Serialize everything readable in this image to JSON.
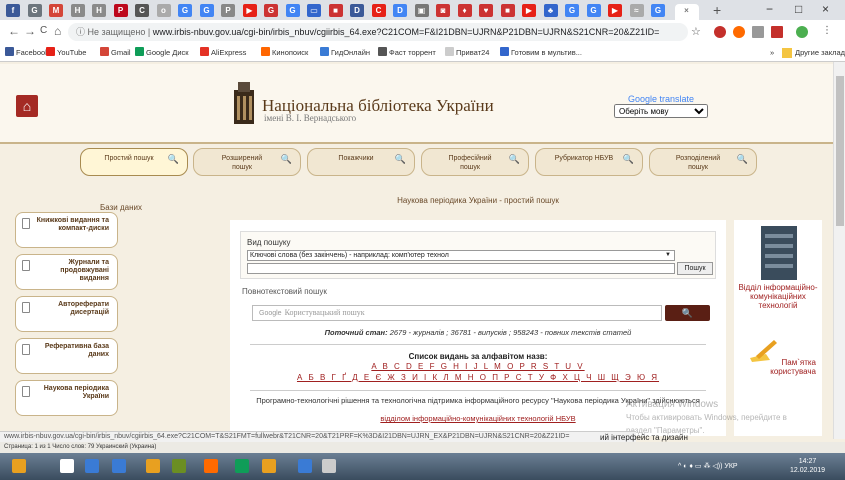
{
  "browser": {
    "tab_icons": [
      {
        "glyph": "f",
        "color": "#3b5998"
      },
      {
        "glyph": "G",
        "color": "#6c757d"
      },
      {
        "glyph": "M",
        "color": "#d44638"
      },
      {
        "glyph": "H",
        "color": "#8a8a8a"
      },
      {
        "glyph": "H",
        "color": "#8a8a8a"
      },
      {
        "glyph": "P",
        "color": "#bd081c"
      },
      {
        "glyph": "C",
        "color": "#555555"
      },
      {
        "glyph": "o",
        "color": "#aaaaaa"
      },
      {
        "glyph": "G",
        "color": "#4285f4"
      },
      {
        "glyph": "G",
        "color": "#4285f4"
      },
      {
        "glyph": "P",
        "color": "#888888"
      },
      {
        "glyph": "▶",
        "color": "#e62117"
      },
      {
        "glyph": "G",
        "color": "#cc3333"
      },
      {
        "glyph": "G",
        "color": "#4285f4"
      },
      {
        "glyph": "▭",
        "color": "#3366cc"
      },
      {
        "glyph": "■",
        "color": "#cc3333"
      },
      {
        "glyph": "D",
        "color": "#3b5998"
      },
      {
        "glyph": "C",
        "color": "#e62117"
      },
      {
        "glyph": "D",
        "color": "#4285f4"
      },
      {
        "glyph": "▣",
        "color": "#777777"
      },
      {
        "glyph": "◙",
        "color": "#cc3333"
      },
      {
        "glyph": "♦",
        "color": "#cc3333"
      },
      {
        "glyph": "♥",
        "color": "#cc3333"
      },
      {
        "glyph": "■",
        "color": "#cc3333"
      },
      {
        "glyph": "▶",
        "color": "#e62117"
      },
      {
        "glyph": "♣",
        "color": "#3366cc"
      },
      {
        "glyph": "G",
        "color": "#4285f4"
      },
      {
        "glyph": "G",
        "color": "#4285f4"
      },
      {
        "glyph": "▶",
        "color": "#e62117"
      },
      {
        "glyph": "≈",
        "color": "#aaaaaa"
      },
      {
        "glyph": "G",
        "color": "#4285f4"
      }
    ],
    "active_tab_close": "×",
    "new_tab": "+",
    "window_controls": {
      "minimize": "−",
      "maximize": "□",
      "close": "×"
    },
    "nav": {
      "back": "←",
      "forward": "→",
      "reload": "C",
      "home": "⌂"
    },
    "security": "ⓘ Не защищено",
    "url": "www.irbis-nbuv.gov.ua/cgi-bin/irbis_nbuv/cgiirbis_64.exe?C21COM=F&I21DBN=UJRN&P21DBN=UJRN&S21CNR=20&Z21ID=",
    "star": "☆",
    "bookmarks": [
      {
        "label": "Facebook",
        "color": "#3b5998"
      },
      {
        "label": "YouTube",
        "color": "#e62117"
      },
      {
        "label": "Gmail",
        "color": "#d44638"
      },
      {
        "label": "Google Диск",
        "color": "#0f9d58"
      },
      {
        "label": "AliExpress",
        "color": "#e43225"
      },
      {
        "label": "Кинопоиск",
        "color": "#f60"
      },
      {
        "label": "ГидОнлайн",
        "color": "#3a7bd5"
      },
      {
        "label": "Фаст торрент",
        "color": "#555555"
      },
      {
        "label": "Приват24",
        "color": "#cccccc"
      },
      {
        "label": "Готовим в мультив...",
        "color": "#3366cc"
      }
    ],
    "bookmarks_more": "»",
    "other_bookmarks": "Другие закладки"
  },
  "header": {
    "title": "Національна бібліотека України",
    "subtitle": "імені В. І. Вернадського",
    "home_icon": "⌂",
    "translate_brand": "Google translate",
    "translate_select": "Оберіть мову"
  },
  "search_tabs": [
    {
      "label": "Простий пошук",
      "active": true
    },
    {
      "label": "Розширений пошук",
      "active": false
    },
    {
      "label": "Покажчики",
      "active": false
    },
    {
      "label": "Професійний пошук",
      "active": false
    },
    {
      "label": "Рубрикатор НБУВ",
      "active": false
    },
    {
      "label": "Розподілений пошук",
      "active": false
    }
  ],
  "sidebar": {
    "title": "Бази даних",
    "items": [
      {
        "label": "Книжкові видання та компакт-диски"
      },
      {
        "label": "Журнали та продовжувані видання"
      },
      {
        "label": "Автореферати дисертацій"
      },
      {
        "label": "Реферативна база даних"
      },
      {
        "label": "Наукова періодика України"
      }
    ]
  },
  "main": {
    "title": "Наукова періодика України - простий пошук",
    "vid_label": "Вид пошуку",
    "vid_select": "Ключові слова (без закінчень) - наприклад: комп'ютер технол",
    "search_button": "Пошук",
    "fulltext_label": "Повнотекстовий пошук",
    "fulltext_google": "Google",
    "fulltext_placeholder": "Користувацький пошук",
    "fulltext_button": "🔍",
    "status_label": "Поточний стан:",
    "status_text": "2679 - журналів ; 36781 - випусків ; 958243 - повних текстів статей",
    "alpha_title": "Список видань за алфавітом назв:",
    "alpha_latin": "A B C D E F G H I J L M O P R S T U V",
    "alpha_cyr": "А Б В Г Ґ Д Е Є Ж З И І К Л М Н О П Р С Т У Ф Х Ц Ч Ш Щ Э Ю Я",
    "footnote": "Програмно-технологічні рішення та технологічна підтримка інформаційного ресурсу \"Наукова періодика України\" здійснюються",
    "footlink": "відділом інформаційно-комунікаційних технологій НБУВ"
  },
  "right": {
    "dept_label": "Відділ інформаційно-комунікаційних технологій",
    "memo_label": "Пам`ятка користувача"
  },
  "status_url": "www.irbis-nbuv.gov.ua/cgi-bin/irbis_nbuv/cgiirbis_64.exe?C21COM=T&S21FMT=fullwebr&T21CNR=20&T21PRF=K%3D&I21DBN=UJRN_EX&P21DBN=UJRN&S21CNR=20&Z21ID=",
  "status_bar": "Страница: 1 из 1   Число слов: 79   Украинский (Украина)",
  "overlay_text": "ий інтерфейс та дизайн",
  "watermark": {
    "line1": "Активация Windows",
    "line2": "Чтобы активировать Windows, перейдите в",
    "line3": "раздел \"Параметры\"."
  },
  "taskbar": {
    "tray": "^ ◐ ♦ ▭ ⁂ ◁)) УКР",
    "time": "14:27",
    "date": "12.02.2019",
    "icons": [
      {
        "color": "#e8a020"
      },
      {
        "color": "#ffffff"
      },
      {
        "color": "#3a7bd5"
      },
      {
        "color": "#3a7bd5"
      },
      {
        "color": "#e8a020"
      },
      {
        "color": "#6b8e23"
      },
      {
        "color": "#ff6a00"
      },
      {
        "color": "#0f9d58"
      },
      {
        "color": "#e8a020"
      },
      {
        "color": "#3a7bd5"
      },
      {
        "color": "#cccccc"
      }
    ]
  }
}
